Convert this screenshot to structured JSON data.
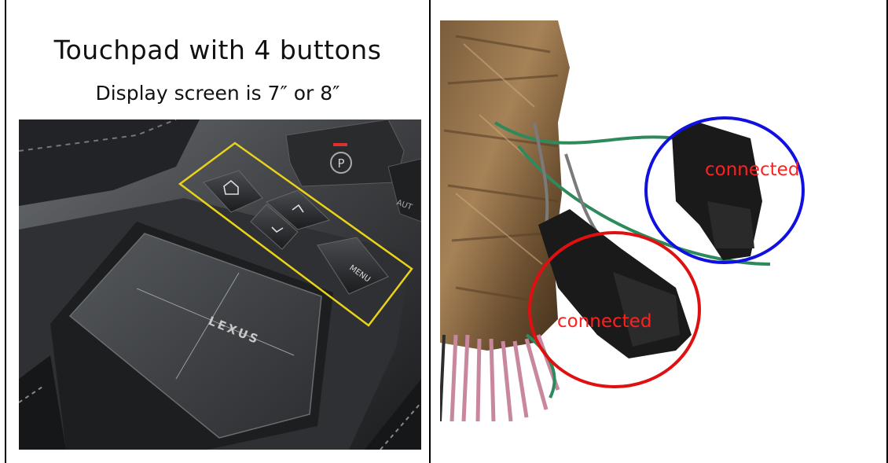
{
  "left_panel": {
    "title": "Touchpad with 4 buttons",
    "subtitle": "Display screen is 7″ or 8″",
    "photo": {
      "brand_text": "LEXUS",
      "menu_button_text": "MENU",
      "parking_brake_text": "P",
      "auto_text": "AUT",
      "highlight_color": "#e8d21a"
    }
  },
  "right_panel": {
    "connector_top": {
      "label": "connected",
      "circle_color": "#1010e0"
    },
    "connector_bottom": {
      "label": "connected",
      "circle_color": "#e01010"
    },
    "label_color": "#ff2020"
  }
}
